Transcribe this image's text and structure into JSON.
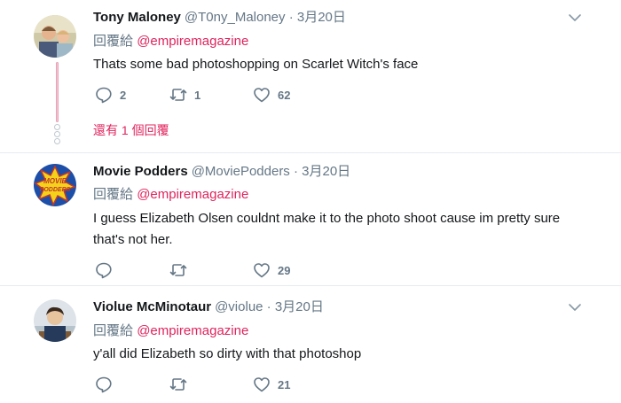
{
  "icons": {
    "reply": "reply-icon",
    "retweet": "retweet-icon",
    "like": "heart-icon",
    "menu": "chevron-down-icon"
  },
  "colors": {
    "accent": "#e0245e",
    "secondary_text": "#657786",
    "divider": "#e6ecf0"
  },
  "tweets": [
    {
      "name": "Tony Maloney",
      "handle": "@T0ny_Maloney",
      "separator": "·",
      "time": "3月20日",
      "replying_label": "回覆給",
      "replying_to": "@empiremagazine",
      "text": "Thats some bad photoshopping on Scarlet Witch's face",
      "reply_count": "2",
      "retweet_count": "1",
      "like_count": "62",
      "more_replies": "還有 1 個回覆"
    },
    {
      "name": "Movie Podders",
      "handle": "@MoviePodders",
      "separator": "·",
      "time": "3月20日",
      "replying_label": "回覆給",
      "replying_to": "@empiremagazine",
      "text": "I guess Elizabeth Olsen couldnt make it to the photo shoot cause im pretty sure that's not her.",
      "reply_count": "",
      "retweet_count": "",
      "like_count": "29",
      "avatar_text": "MOVIE PODDERS"
    },
    {
      "name": "Violue McMinotaur",
      "handle": "@violue",
      "separator": "·",
      "time": "3月20日",
      "replying_label": "回覆給",
      "replying_to": "@empiremagazine",
      "text": "y'all did Elizabeth so dirty with that photoshop",
      "reply_count": "",
      "retweet_count": "",
      "like_count": "21"
    }
  ]
}
